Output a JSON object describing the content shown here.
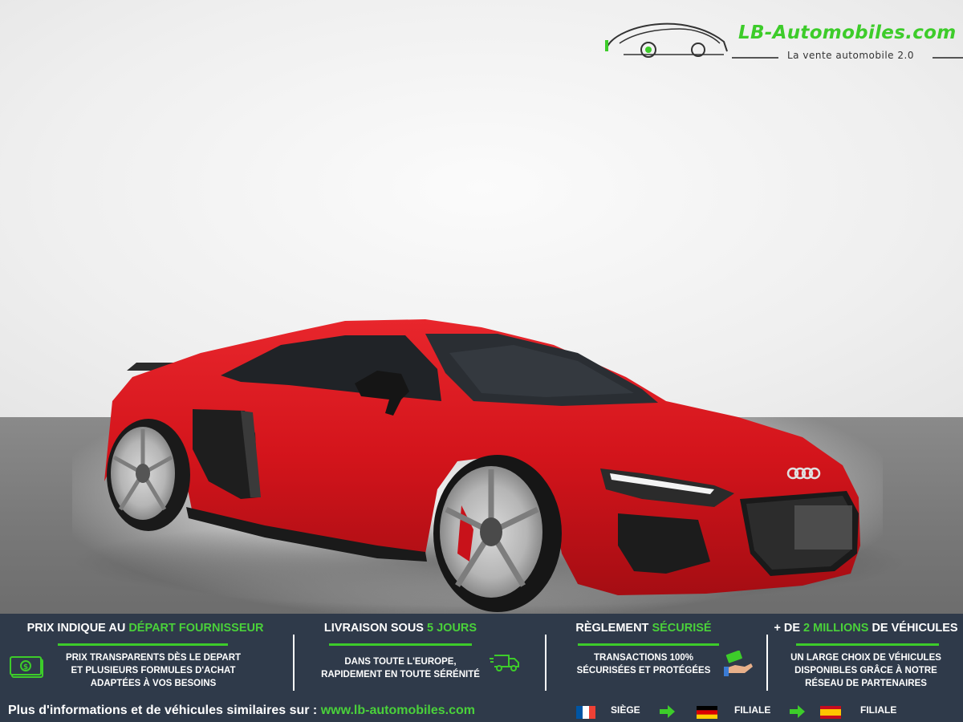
{
  "logo": {
    "brand": "LB-Automobiles.com",
    "tagline": "La vente automobile 2.0"
  },
  "features": [
    {
      "title_prefix": "PRIX INDIQUE AU ",
      "title_accent": "DÉPART FOURNISSEUR",
      "title_suffix": "",
      "lines": [
        "PRIX TRANSPARENTS DÈS LE DEPART",
        "ET PLUSIEURS FORMULES D'ACHAT",
        "ADAPTÉES À VOS BESOINS"
      ],
      "icon": "money-icon"
    },
    {
      "title_prefix": "LIVRAISON SOUS ",
      "title_accent": "5 JOURS",
      "title_suffix": "",
      "lines": [
        "DANS TOUTE L'EUROPE,",
        "RAPIDEMENT EN TOUTE SÉRÉNITÉ"
      ],
      "icon": "delivery-truck-icon"
    },
    {
      "title_prefix": "RÈGLEMENT ",
      "title_accent": "SÉCURISÉ",
      "title_suffix": "",
      "lines": [
        "TRANSACTIONS 100%",
        "SÉCURISÉES ET PROTÉGÉES"
      ],
      "icon": "payment-hand-icon"
    },
    {
      "title_prefix": "+ DE ",
      "title_accent": "2 MILLIONS",
      "title_suffix": " DE VÉHICULES",
      "lines": [
        "UN LARGE CHOIX DE VÉHICULES",
        "DISPONIBLES GRÂCE À NOTRE",
        "RÉSEAU DE PARTENAIRES"
      ],
      "icon": ""
    }
  ],
  "info": {
    "text": "Plus d'informations et de véhicules similaires sur : ",
    "url": "www.lb-automobiles.com"
  },
  "locations": [
    {
      "flag": "france-flag",
      "label": "SIÈGE"
    },
    {
      "flag": "germany-flag",
      "label": "FILIALE"
    },
    {
      "flag": "spain-flag",
      "label": "FILIALE"
    }
  ],
  "colors": {
    "accent_green": "#3dcc2a",
    "footer_bg": "#2f3a4a",
    "car_red": "#d4141c"
  }
}
